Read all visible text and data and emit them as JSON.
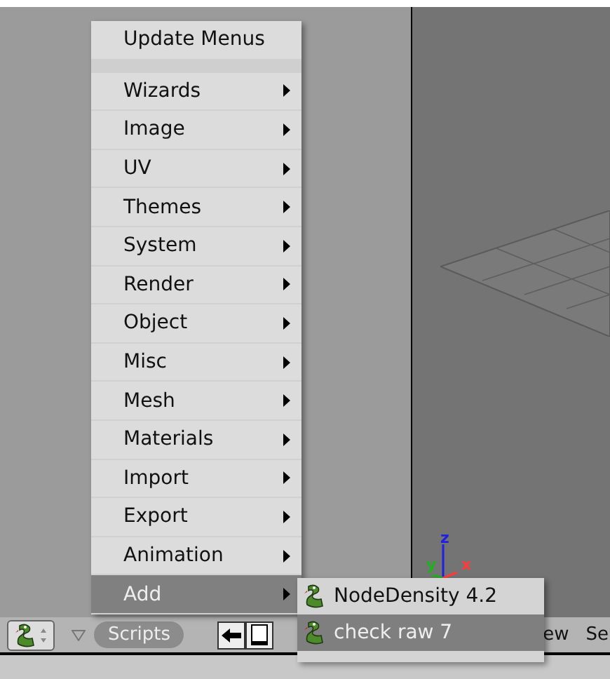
{
  "menu": {
    "items": [
      {
        "kind": "action",
        "label": "Update Menus",
        "selected": false
      },
      {
        "kind": "separator"
      },
      {
        "kind": "submenu",
        "label": "Wizards",
        "selected": false
      },
      {
        "kind": "submenu",
        "label": "Image",
        "selected": false
      },
      {
        "kind": "submenu",
        "label": "UV",
        "selected": false
      },
      {
        "kind": "submenu",
        "label": "Themes",
        "selected": false
      },
      {
        "kind": "submenu",
        "label": "System",
        "selected": false
      },
      {
        "kind": "submenu",
        "label": "Render",
        "selected": false
      },
      {
        "kind": "submenu",
        "label": "Object",
        "selected": false
      },
      {
        "kind": "submenu",
        "label": "Misc",
        "selected": false
      },
      {
        "kind": "submenu",
        "label": "Mesh",
        "selected": false
      },
      {
        "kind": "submenu",
        "label": "Materials",
        "selected": false
      },
      {
        "kind": "submenu",
        "label": "Import",
        "selected": false
      },
      {
        "kind": "submenu",
        "label": "Export",
        "selected": false
      },
      {
        "kind": "submenu",
        "label": "Animation",
        "selected": false
      },
      {
        "kind": "submenu",
        "label": "Add",
        "selected": true
      }
    ]
  },
  "submenu": {
    "items": [
      {
        "label": "NodeDensity 4.2",
        "selected": false
      },
      {
        "label": "check raw 7",
        "selected": true
      }
    ]
  },
  "viewport": {
    "axes": [
      {
        "label": "z",
        "color": "#2020e0"
      },
      {
        "label": "y",
        "color": "#20b020"
      },
      {
        "label": "x",
        "color": "#ff3a3a"
      }
    ]
  },
  "header": {
    "menu_label": "Scripts",
    "header_menus": [
      "ew",
      "Se"
    ]
  }
}
